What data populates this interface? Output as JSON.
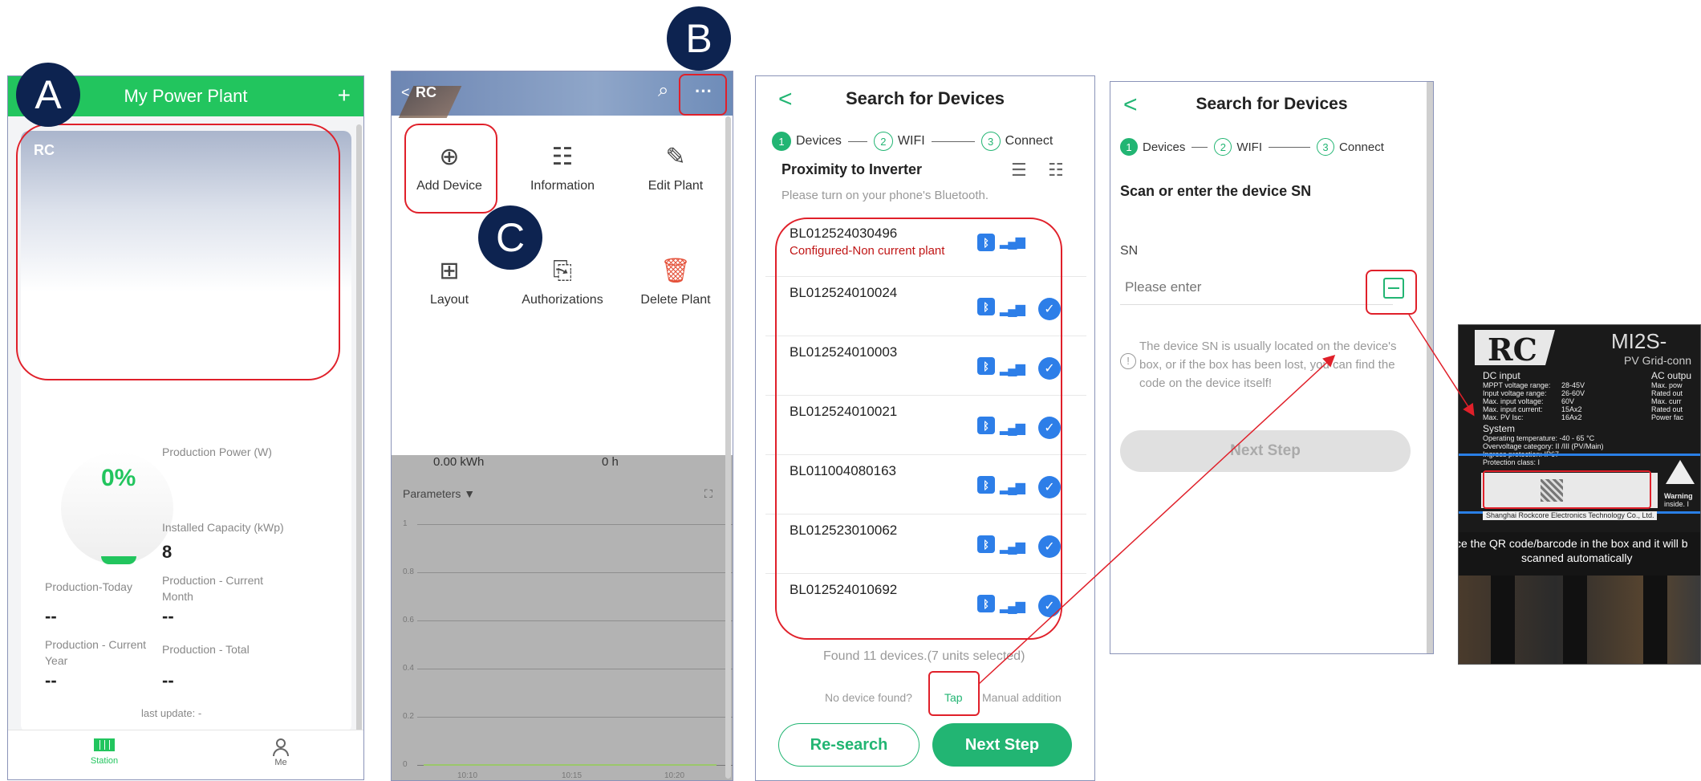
{
  "markers": {
    "a": "A",
    "b": "B",
    "c": "C"
  },
  "plant": {
    "title": "My Power Plant",
    "add": "+",
    "name": "RC",
    "percent": "0%",
    "production_power_label": "Production Power (W)",
    "installed_capacity_label": "Installed Capacity (kWp)",
    "installed_capacity_value": "8",
    "today_label": "Production-Today",
    "today_value": "--",
    "current_month_label": "Production - Current Month",
    "current_month_value": "--",
    "current_year_label": "Production - Current Year",
    "current_year_value": "--",
    "total_label": "Production - Total",
    "total_value": "--",
    "last_update": "last update: -",
    "tabs": [
      {
        "label": "Station",
        "icon": "solar-panel-icon"
      },
      {
        "label": "Me",
        "icon": "person-icon"
      }
    ]
  },
  "plant_menu": {
    "back": "<",
    "title": "RC",
    "search": "⌕",
    "more": "···",
    "items": [
      {
        "label": "Add Device",
        "icon": "add-circle-icon",
        "glyph": "⊕"
      },
      {
        "label": "Information",
        "icon": "list-icon",
        "glyph": "☷"
      },
      {
        "label": "Edit Plant",
        "icon": "edit-icon",
        "glyph": "✎"
      },
      {
        "label": "Layout",
        "icon": "layout-icon",
        "glyph": "⊞"
      },
      {
        "label": "Authorizations",
        "icon": "authorization-icon",
        "glyph": "⎘"
      },
      {
        "label": "Delete Plant",
        "icon": "trash-icon",
        "glyph": "🗑"
      }
    ],
    "energy_value": "0.00 kWh",
    "hours_value": "0 h",
    "parameters_label": "Parameters ▼",
    "expand": "⛶",
    "y_ticks": [
      "1",
      "0.8",
      "0.6",
      "0.4",
      "0.2",
      "0"
    ],
    "x_ticks": [
      "10:10",
      "10:15",
      "10:20"
    ]
  },
  "search": {
    "back": "<",
    "title": "Search for Devices",
    "steps": [
      "Devices",
      "WIFI",
      "Connect"
    ],
    "step_numbers": [
      "1",
      "2",
      "3"
    ],
    "proximity_title": "Proximity to Inverter",
    "bluetooth_hint": "Please turn on your phone's Bluetooth.",
    "devices": [
      {
        "sn": "BL012524030496",
        "warning": "Configured-Non current plant",
        "selected": false
      },
      {
        "sn": "BL012524010024",
        "warning": "",
        "selected": true
      },
      {
        "sn": "BL012524010003",
        "warning": "",
        "selected": true
      },
      {
        "sn": "BL012524010021",
        "warning": "",
        "selected": true
      },
      {
        "sn": "BL011004080163",
        "warning": "",
        "selected": true
      },
      {
        "sn": "BL012523010062",
        "warning": "",
        "selected": true
      },
      {
        "sn": "BL012524010692",
        "warning": "",
        "selected": true
      }
    ],
    "found_summary": "Found 11 devices.(7 units selected)",
    "no_device": "No device found?",
    "tap": "Tap",
    "manual": "Manual addition",
    "research_button": "Re-search",
    "next_button": "Next Step"
  },
  "sn_entry": {
    "back": "<",
    "title": "Search for Devices",
    "steps": [
      "Devices",
      "WIFI",
      "Connect"
    ],
    "step_numbers": [
      "1",
      "2",
      "3"
    ],
    "heading": "Scan or enter the device SN",
    "sn_label": "SN",
    "placeholder": "Please enter",
    "hint": "The device SN is usually located on the device's box, or if the box has been lost, you can find the code on the device itself!",
    "next_button": "Next Step"
  },
  "photo": {
    "brand": "RC",
    "model": "MI2S-",
    "subtitle": "PV Grid-conn",
    "dc_input": "DC input",
    "specs_left": [
      "MPPT voltage range:",
      "Input voltage range:",
      "Max. input voltage:",
      "Max. input current:",
      "Max. PV Isc:"
    ],
    "specs_values": [
      "28-45V",
      "26-60V",
      "60V",
      "15Ax2",
      "16Ax2"
    ],
    "ac_output": "AC outpu",
    "specs_right": [
      "Max. pow",
      "Rated out",
      "Max. curr",
      "Rated out",
      "Power fac"
    ],
    "system": "System",
    "system_specs": [
      "Operating temperature:  -40 - 65 °C",
      "Overvoltage category:  II /III (PV/Main)",
      "Ingress protection:  IP67",
      "Protection class:  I"
    ],
    "warning": "Warning",
    "inside": "inside. I",
    "manufacturer": "Shanghai Rockcore Electronics Technology Co., Ltd.",
    "scan_hint_1": "ce the QR code/barcode in the box and it will b",
    "scan_hint_2": "scanned automatically"
  }
}
